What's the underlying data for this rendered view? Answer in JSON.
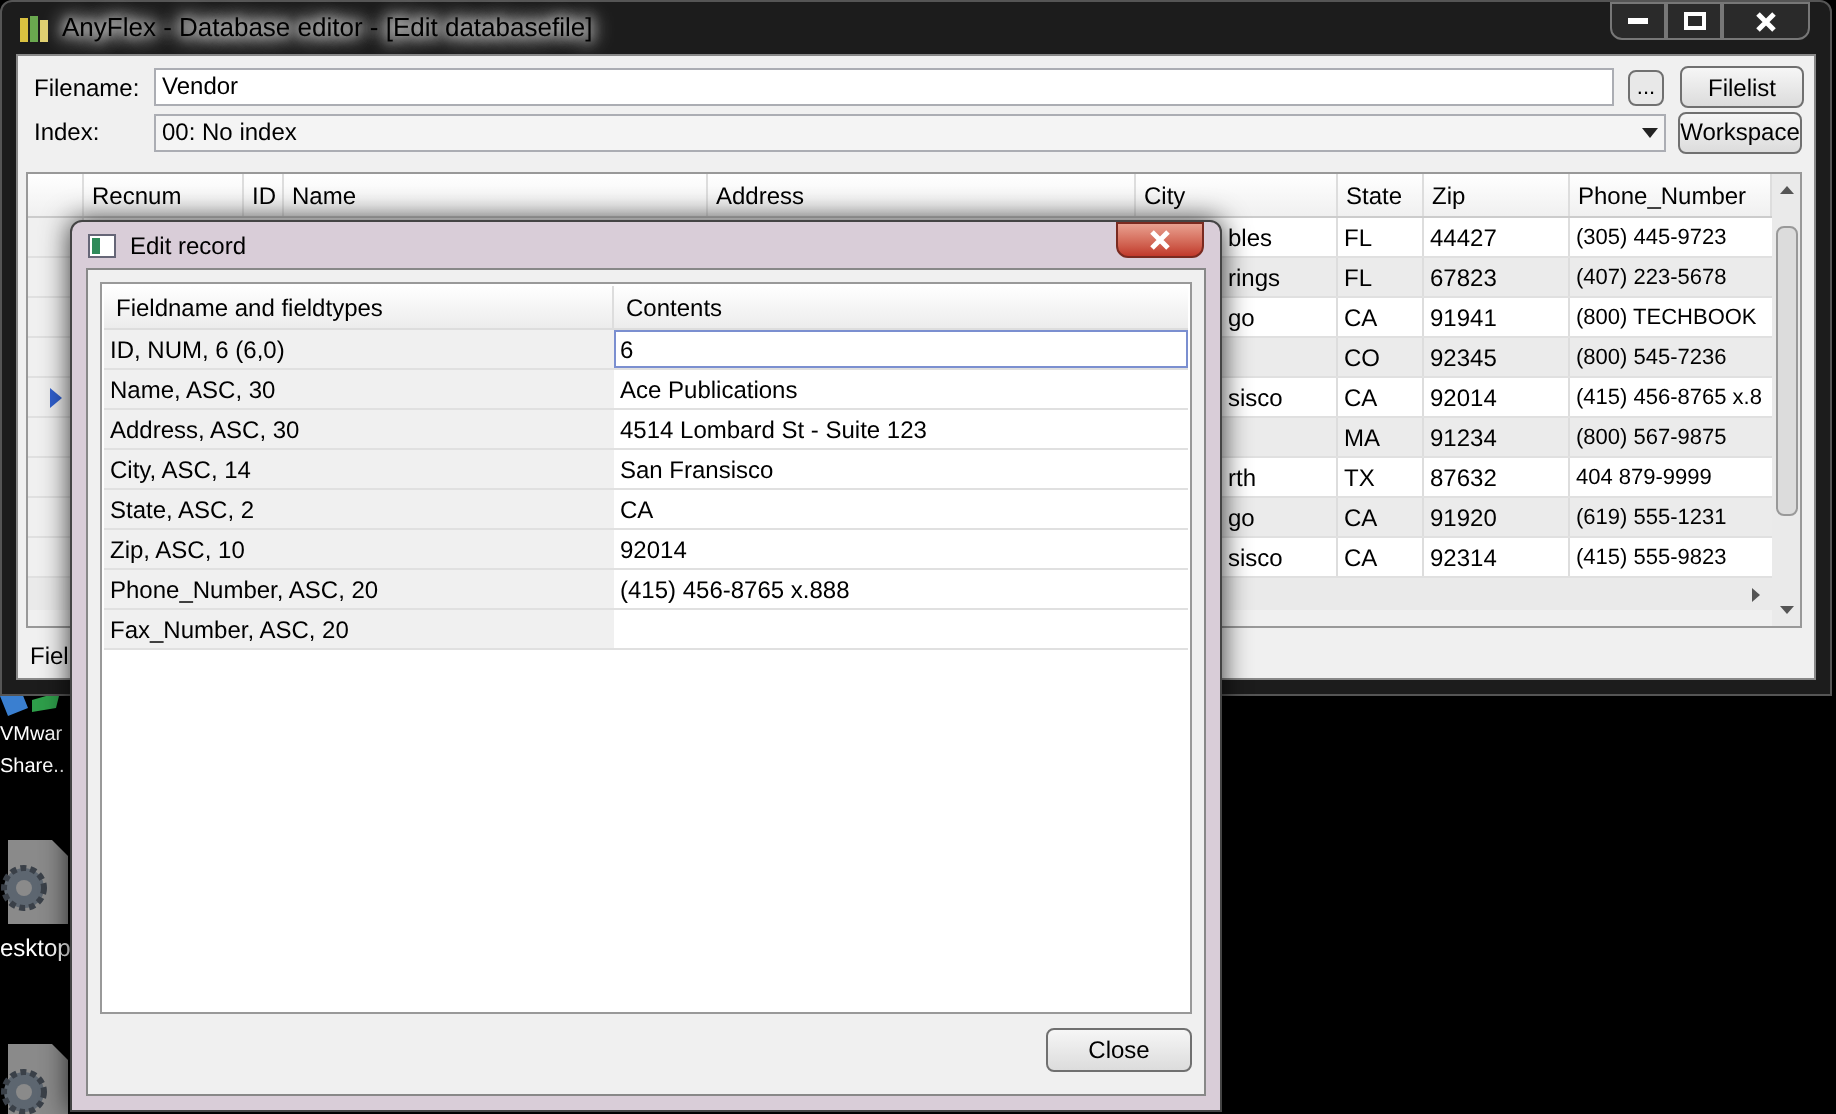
{
  "window": {
    "title": "AnyFlex - Database editor - [Edit databasefile]"
  },
  "filename": {
    "label": "Filename:",
    "value": "Vendor",
    "browse_button": "...",
    "filelist_button": "Filelist"
  },
  "index": {
    "label": "Index:",
    "value": "00: No index",
    "workspace_button": "Workspace"
  },
  "grid": {
    "columns": [
      "Recnum",
      "ID",
      "Name",
      "Address",
      "City",
      "State",
      "Zip",
      "Phone_Number"
    ],
    "rows": [
      {
        "selected": false,
        "city": "bles",
        "state": "FL",
        "zip": "44427",
        "phone_number": "(305) 445-9723"
      },
      {
        "selected": false,
        "city": "rings",
        "state": "FL",
        "zip": "67823",
        "phone_number": "(407) 223-5678"
      },
      {
        "selected": false,
        "city": "go",
        "state": "CA",
        "zip": "91941",
        "phone_number": "(800) TECHBOOK"
      },
      {
        "selected": false,
        "state": "CO",
        "zip": "92345",
        "phone_number": "(800) 545-7236"
      },
      {
        "selected": true,
        "city": "sisco",
        "state": "CA",
        "zip": "92014",
        "phone_number": "(415) 456-8765 x.8"
      },
      {
        "selected": false,
        "state": "MA",
        "zip": "91234",
        "phone_number": "(800) 567-9875"
      },
      {
        "selected": false,
        "city": "rth",
        "state": "TX",
        "zip": "87632",
        "phone_number": "404 879-9999"
      },
      {
        "selected": false,
        "city": "go",
        "state": "CA",
        "zip": "91920",
        "phone_number": "(619) 555-1231"
      },
      {
        "selected": false,
        "city": "sisco",
        "state": "CA",
        "zip": "92314",
        "phone_number": "(415) 555-9823"
      }
    ]
  },
  "status_bar": {
    "text": "Fiel"
  },
  "desktop_icons": [
    {
      "lines": [
        "VMwar",
        "Share.."
      ]
    },
    {
      "lines": [
        "esktop"
      ]
    }
  ],
  "dialog": {
    "title": "Edit record",
    "columns": [
      "Fieldname and fieldtypes",
      "Contents"
    ],
    "rows": [
      {
        "field": "ID, NUM, 6 (6,0)",
        "contents": "6",
        "focused": true
      },
      {
        "field": "Name, ASC, 30",
        "contents": "Ace Publications",
        "focused": false
      },
      {
        "field": "Address, ASC, 30",
        "contents": "4514 Lombard St - Suite 123",
        "focused": false
      },
      {
        "field": "City, ASC, 14",
        "contents": "San Fransisco",
        "focused": false
      },
      {
        "field": "State, ASC, 2",
        "contents": "CA",
        "focused": false
      },
      {
        "field": "Zip, ASC, 10",
        "contents": "92014",
        "focused": false
      },
      {
        "field": "Phone_Number, ASC, 20",
        "contents": "(415) 456-8765 x.888",
        "focused": false
      },
      {
        "field": "Fax_Number, ASC, 20",
        "focused": false
      }
    ],
    "close_button": "Close"
  }
}
